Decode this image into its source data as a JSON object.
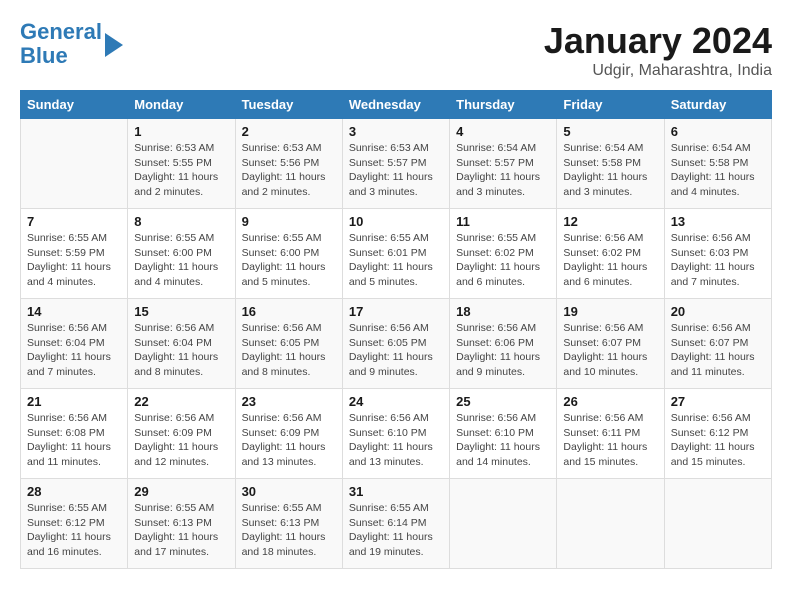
{
  "header": {
    "logo_line1": "General",
    "logo_line2": "Blue",
    "month_title": "January 2024",
    "location": "Udgir, Maharashtra, India"
  },
  "days_of_week": [
    "Sunday",
    "Monday",
    "Tuesday",
    "Wednesday",
    "Thursday",
    "Friday",
    "Saturday"
  ],
  "weeks": [
    [
      {
        "day": "",
        "info": ""
      },
      {
        "day": "1",
        "info": "Sunrise: 6:53 AM\nSunset: 5:55 PM\nDaylight: 11 hours\nand 2 minutes."
      },
      {
        "day": "2",
        "info": "Sunrise: 6:53 AM\nSunset: 5:56 PM\nDaylight: 11 hours\nand 2 minutes."
      },
      {
        "day": "3",
        "info": "Sunrise: 6:53 AM\nSunset: 5:57 PM\nDaylight: 11 hours\nand 3 minutes."
      },
      {
        "day": "4",
        "info": "Sunrise: 6:54 AM\nSunset: 5:57 PM\nDaylight: 11 hours\nand 3 minutes."
      },
      {
        "day": "5",
        "info": "Sunrise: 6:54 AM\nSunset: 5:58 PM\nDaylight: 11 hours\nand 3 minutes."
      },
      {
        "day": "6",
        "info": "Sunrise: 6:54 AM\nSunset: 5:58 PM\nDaylight: 11 hours\nand 4 minutes."
      }
    ],
    [
      {
        "day": "7",
        "info": "Sunrise: 6:55 AM\nSunset: 5:59 PM\nDaylight: 11 hours\nand 4 minutes."
      },
      {
        "day": "8",
        "info": "Sunrise: 6:55 AM\nSunset: 6:00 PM\nDaylight: 11 hours\nand 4 minutes."
      },
      {
        "day": "9",
        "info": "Sunrise: 6:55 AM\nSunset: 6:00 PM\nDaylight: 11 hours\nand 5 minutes."
      },
      {
        "day": "10",
        "info": "Sunrise: 6:55 AM\nSunset: 6:01 PM\nDaylight: 11 hours\nand 5 minutes."
      },
      {
        "day": "11",
        "info": "Sunrise: 6:55 AM\nSunset: 6:02 PM\nDaylight: 11 hours\nand 6 minutes."
      },
      {
        "day": "12",
        "info": "Sunrise: 6:56 AM\nSunset: 6:02 PM\nDaylight: 11 hours\nand 6 minutes."
      },
      {
        "day": "13",
        "info": "Sunrise: 6:56 AM\nSunset: 6:03 PM\nDaylight: 11 hours\nand 7 minutes."
      }
    ],
    [
      {
        "day": "14",
        "info": "Sunrise: 6:56 AM\nSunset: 6:04 PM\nDaylight: 11 hours\nand 7 minutes."
      },
      {
        "day": "15",
        "info": "Sunrise: 6:56 AM\nSunset: 6:04 PM\nDaylight: 11 hours\nand 8 minutes."
      },
      {
        "day": "16",
        "info": "Sunrise: 6:56 AM\nSunset: 6:05 PM\nDaylight: 11 hours\nand 8 minutes."
      },
      {
        "day": "17",
        "info": "Sunrise: 6:56 AM\nSunset: 6:05 PM\nDaylight: 11 hours\nand 9 minutes."
      },
      {
        "day": "18",
        "info": "Sunrise: 6:56 AM\nSunset: 6:06 PM\nDaylight: 11 hours\nand 9 minutes."
      },
      {
        "day": "19",
        "info": "Sunrise: 6:56 AM\nSunset: 6:07 PM\nDaylight: 11 hours\nand 10 minutes."
      },
      {
        "day": "20",
        "info": "Sunrise: 6:56 AM\nSunset: 6:07 PM\nDaylight: 11 hours\nand 11 minutes."
      }
    ],
    [
      {
        "day": "21",
        "info": "Sunrise: 6:56 AM\nSunset: 6:08 PM\nDaylight: 11 hours\nand 11 minutes."
      },
      {
        "day": "22",
        "info": "Sunrise: 6:56 AM\nSunset: 6:09 PM\nDaylight: 11 hours\nand 12 minutes."
      },
      {
        "day": "23",
        "info": "Sunrise: 6:56 AM\nSunset: 6:09 PM\nDaylight: 11 hours\nand 13 minutes."
      },
      {
        "day": "24",
        "info": "Sunrise: 6:56 AM\nSunset: 6:10 PM\nDaylight: 11 hours\nand 13 minutes."
      },
      {
        "day": "25",
        "info": "Sunrise: 6:56 AM\nSunset: 6:10 PM\nDaylight: 11 hours\nand 14 minutes."
      },
      {
        "day": "26",
        "info": "Sunrise: 6:56 AM\nSunset: 6:11 PM\nDaylight: 11 hours\nand 15 minutes."
      },
      {
        "day": "27",
        "info": "Sunrise: 6:56 AM\nSunset: 6:12 PM\nDaylight: 11 hours\nand 15 minutes."
      }
    ],
    [
      {
        "day": "28",
        "info": "Sunrise: 6:55 AM\nSunset: 6:12 PM\nDaylight: 11 hours\nand 16 minutes."
      },
      {
        "day": "29",
        "info": "Sunrise: 6:55 AM\nSunset: 6:13 PM\nDaylight: 11 hours\nand 17 minutes."
      },
      {
        "day": "30",
        "info": "Sunrise: 6:55 AM\nSunset: 6:13 PM\nDaylight: 11 hours\nand 18 minutes."
      },
      {
        "day": "31",
        "info": "Sunrise: 6:55 AM\nSunset: 6:14 PM\nDaylight: 11 hours\nand 19 minutes."
      },
      {
        "day": "",
        "info": ""
      },
      {
        "day": "",
        "info": ""
      },
      {
        "day": "",
        "info": ""
      }
    ]
  ]
}
